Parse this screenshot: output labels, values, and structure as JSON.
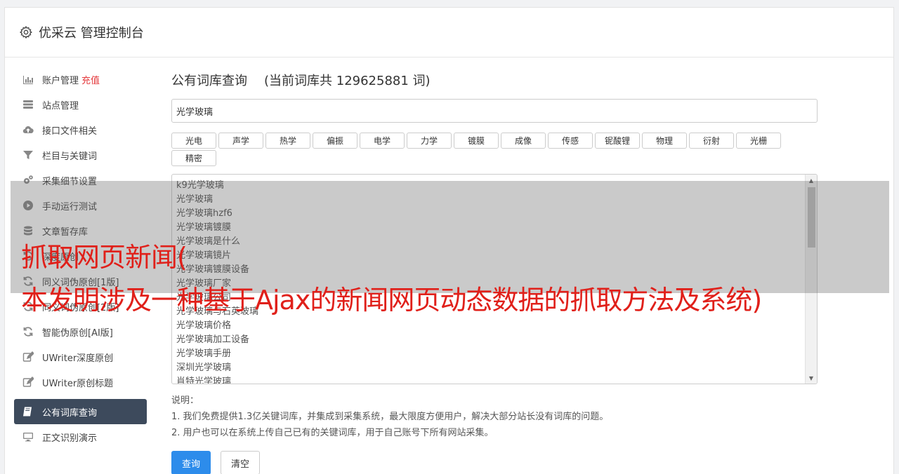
{
  "header": {
    "title": "优采云 管理控制台"
  },
  "sidebar": {
    "items": [
      {
        "label": "账户管理",
        "extra": "充值",
        "icon": "bar-chart-icon"
      },
      {
        "label": "站点管理",
        "icon": "server-icon"
      },
      {
        "label": "接口文件相关",
        "icon": "cloud-upload-icon"
      },
      {
        "label": "栏目与关键词",
        "icon": "filter-icon"
      },
      {
        "label": "采集细节设置",
        "icon": "gears-icon"
      },
      {
        "label": "手动运行测试",
        "icon": "play-circle-icon"
      },
      {
        "label": "文章暂存库",
        "icon": "database-icon"
      },
      {
        "label": "深度原创",
        "icon": "refresh-icon"
      },
      {
        "label": "同义词伪原创[1版]",
        "icon": "refresh-icon"
      },
      {
        "label": "同义词伪原创[2版]",
        "icon": "refresh-icon"
      },
      {
        "label": "智能伪原创[AI版]",
        "icon": "refresh-icon"
      },
      {
        "label": "UWriter深度原创",
        "icon": "edit-icon"
      },
      {
        "label": "UWriter原创标题",
        "icon": "edit-icon"
      },
      {
        "label": "公有词库查询",
        "icon": "book-icon",
        "active": true
      },
      {
        "label": "正文识别演示",
        "icon": "monitor-icon"
      }
    ]
  },
  "main": {
    "heading": "公有词库查询",
    "count_text": "(当前词库共 129625881 词)",
    "input_value": "光学玻璃",
    "tags": [
      "光电",
      "声学",
      "热学",
      "偏振",
      "电学",
      "力学",
      "镀膜",
      "成像",
      "传感",
      "铌酸锂",
      "物理",
      "衍射",
      "光栅",
      "精密"
    ],
    "results": [
      "k9光学玻璃",
      "光学玻璃",
      "光学玻璃hzf6",
      "光学玻璃镀膜",
      "光学玻璃是什么",
      "光学玻璃镜片",
      "光学玻璃镀膜设备",
      "光学玻璃厂家",
      "光学玻璃公司",
      "光学玻璃与石英玻璃",
      "光学玻璃价格",
      "光学玻璃加工设备",
      "光学玻璃手册",
      "深圳光学玻璃",
      "肖特光学玻璃"
    ],
    "notes_title": "说明：",
    "notes": [
      "1. 我们免费提供1.3亿关键词库，并集成到采集系统，最大限度方便用户，解决大部分站长没有词库的问题。",
      "2. 用户也可以在系统上传自己已有的关键词库，用于自己账号下所有网站采集。"
    ],
    "query_button": "查询",
    "clear_button": "清空"
  },
  "overlay": {
    "line1": "抓取网页新闻(",
    "line2": "本发明涉及一种基于Ajax的新闻网页动态数据的抓取方法及系统)"
  },
  "colors": {
    "accent": "#2d8ceb",
    "active_nav": "#3d4a5c",
    "recharge": "#e4393c",
    "overlay_text": "#e0201a"
  }
}
